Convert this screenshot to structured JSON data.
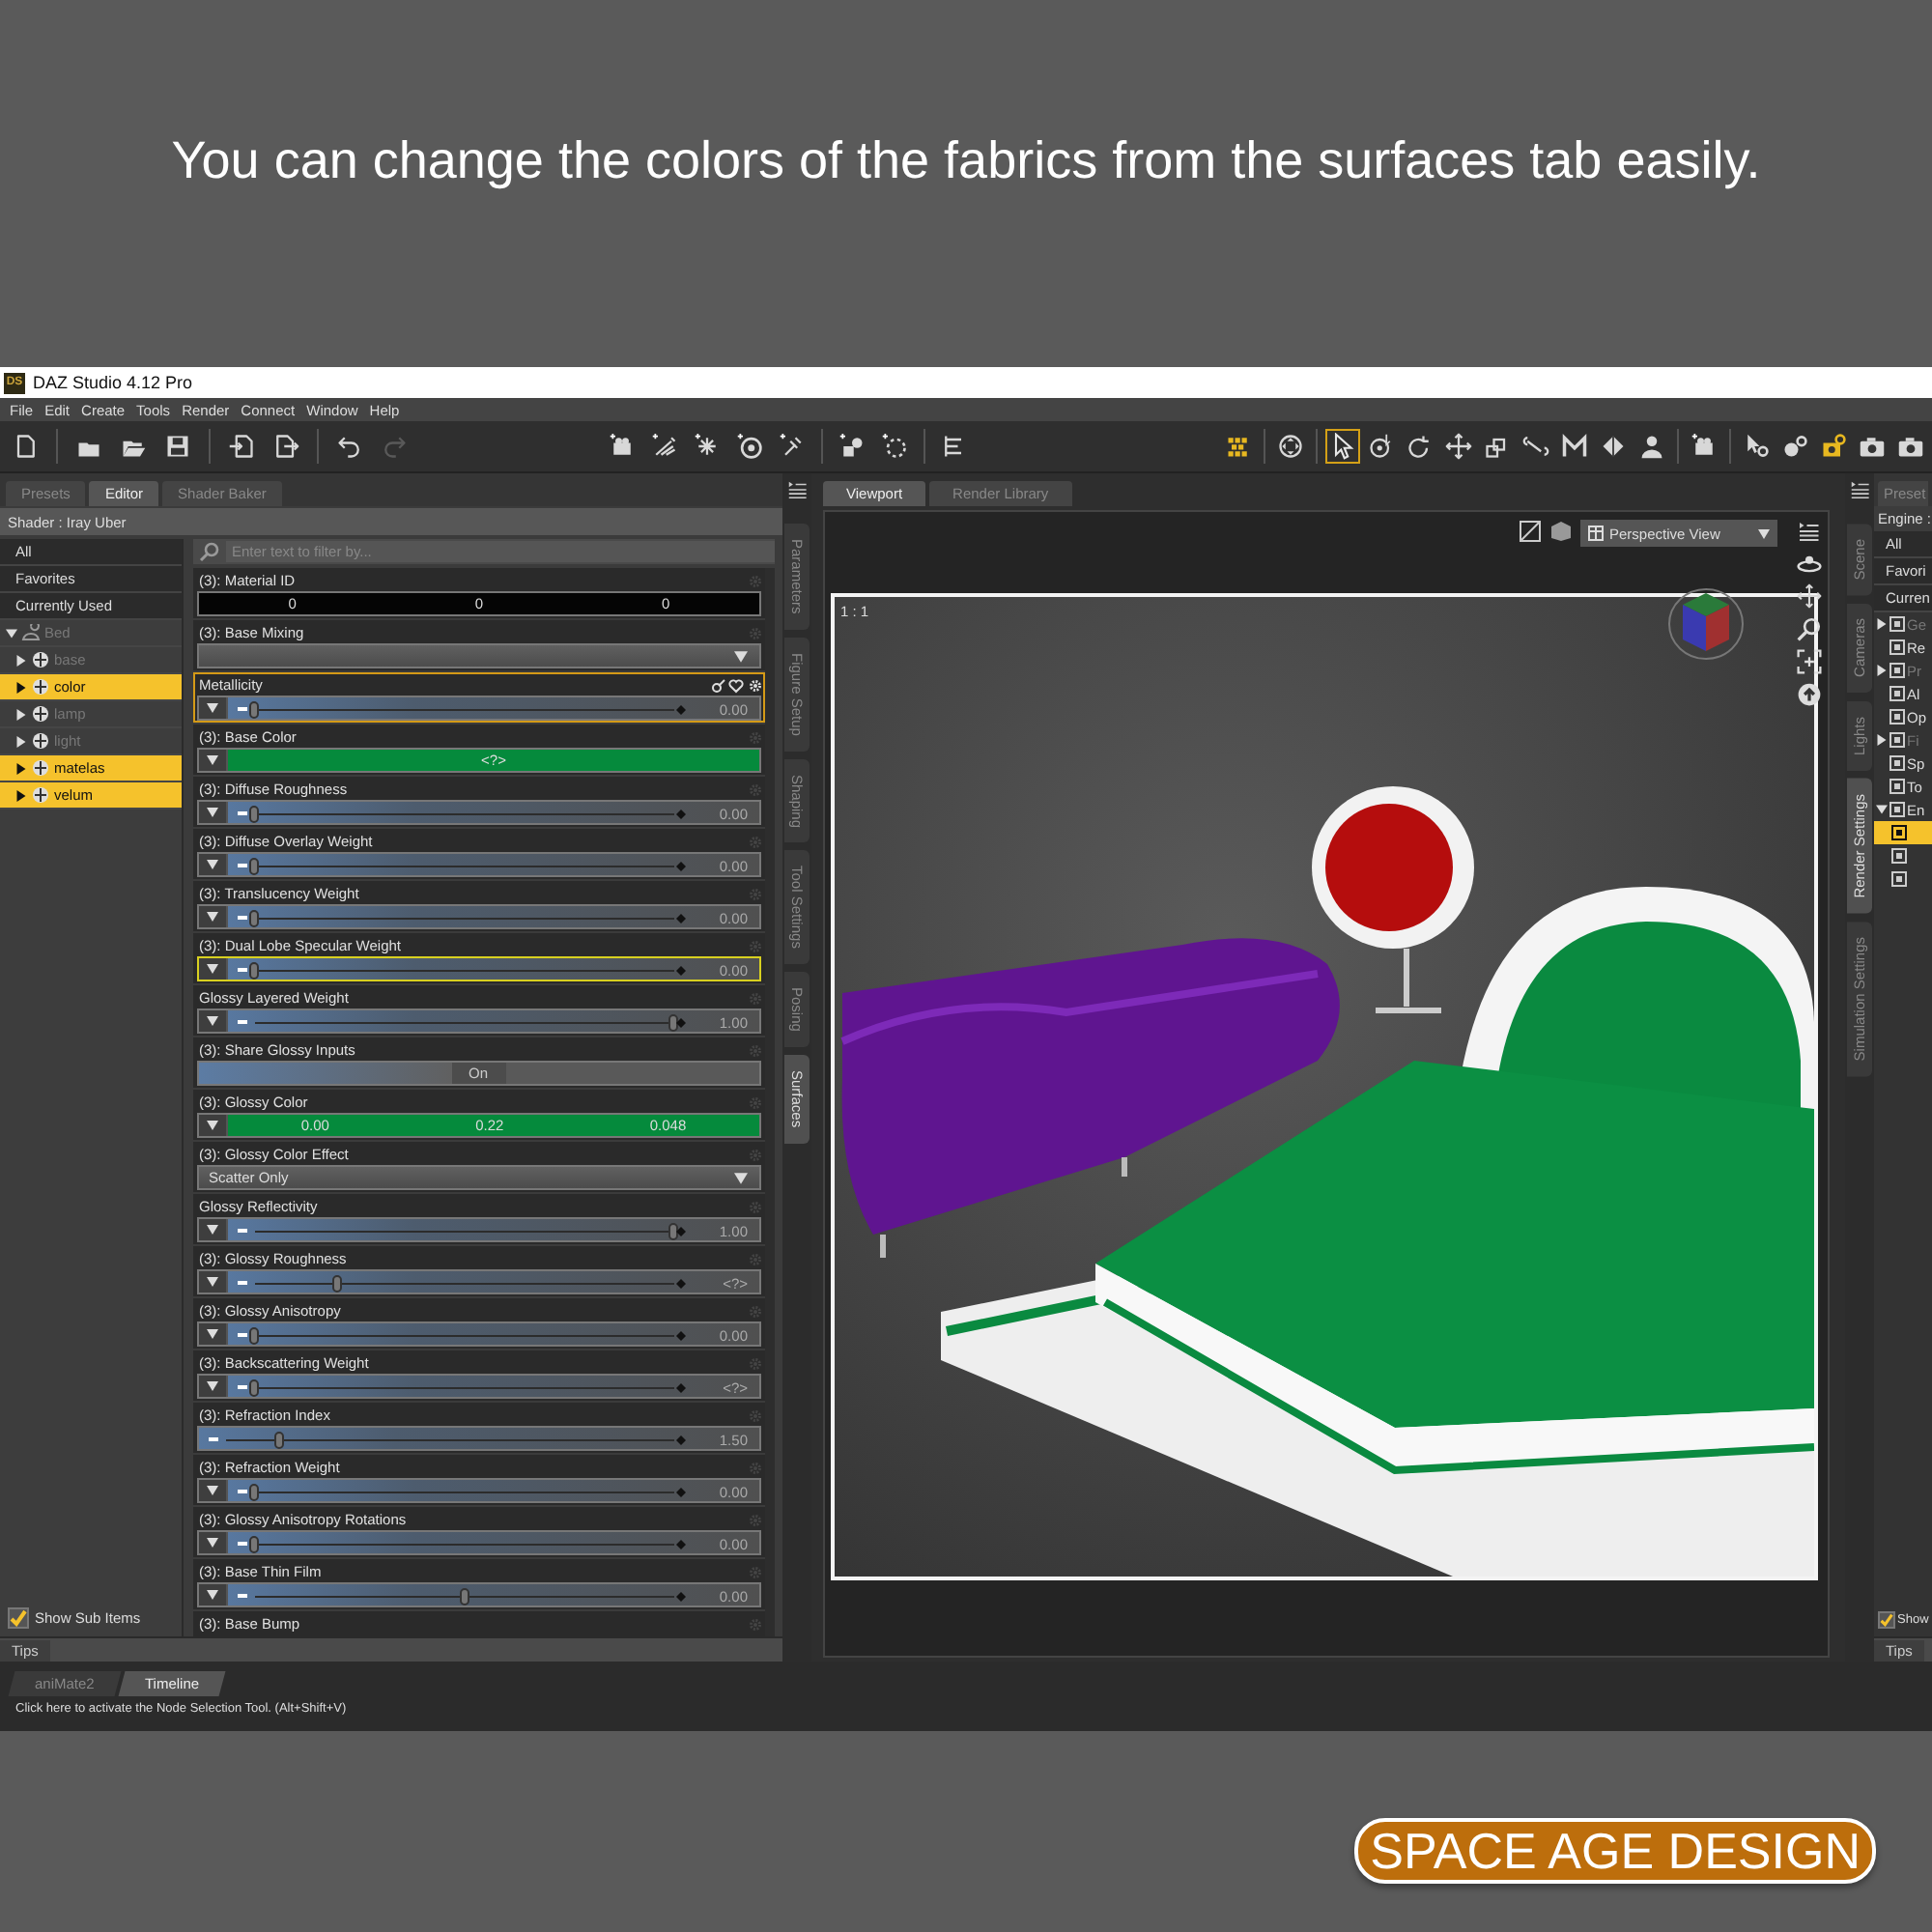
{
  "caption": "You can change the colors of the fabrics from the surfaces tab easily.",
  "window": {
    "icon_text": "DS",
    "title": "DAZ Studio 4.12 Pro"
  },
  "menu": [
    "File",
    "Edit",
    "Create",
    "Tools",
    "Render",
    "Connect",
    "Window",
    "Help"
  ],
  "toolbar": {
    "redo_disabled": true,
    "tools": [
      {
        "selected": false
      },
      {
        "selected": false
      },
      {
        "selected": true
      },
      {
        "selected": false
      },
      {
        "selected": false
      },
      {
        "selected": false
      },
      {
        "selected": false
      },
      {
        "selected": false
      },
      {
        "selected": false
      },
      {
        "selected": false
      },
      {
        "selected": false
      },
      {
        "selected": false
      },
      {
        "selected": false
      },
      {
        "selected": false
      },
      {
        "selected": false
      },
      {
        "selected": false
      },
      {
        "selected": false
      }
    ]
  },
  "surfaces_editor": {
    "tabs": [
      {
        "label": "Presets",
        "selected": false
      },
      {
        "label": "Editor",
        "selected": true
      },
      {
        "label": "Shader Baker",
        "selected": false
      }
    ],
    "shader": "Shader : Iray Uber",
    "categories": [
      {
        "label": "All",
        "selected": false
      },
      {
        "label": "Favorites",
        "selected": false
      },
      {
        "label": "Currently Used",
        "selected": false
      }
    ],
    "tree": [
      {
        "label": "Bed",
        "expanded": true,
        "disabled": true,
        "selected": false,
        "children": [
          {
            "label": "base",
            "disabled": true,
            "selected": false,
            "expanded": false
          },
          {
            "label": "color",
            "disabled": false,
            "selected": true,
            "expanded": false
          },
          {
            "label": "lamp",
            "disabled": true,
            "selected": false,
            "expanded": false
          },
          {
            "label": "light",
            "disabled": true,
            "selected": false,
            "expanded": false
          },
          {
            "label": "matelas",
            "disabled": false,
            "selected": true,
            "expanded": false
          },
          {
            "label": "velum",
            "disabled": false,
            "selected": true,
            "expanded": false
          }
        ]
      }
    ],
    "show_sub_items": {
      "label": "Show Sub Items",
      "checked": true
    },
    "filter": {
      "placeholder": "Enter text to filter by..."
    },
    "properties": [
      {
        "kind": "triple",
        "label": "(3): Material ID",
        "values": [
          "0",
          "0",
          "0"
        ],
        "selected": false,
        "hovered": false
      },
      {
        "kind": "dropdown",
        "label": "(3): Base Mixing",
        "selected": false,
        "hovered": false
      },
      {
        "kind": "slider",
        "label": "Metallicity",
        "level": 0,
        "value": "0.00",
        "menu_button": true,
        "selected": true,
        "hovered": false
      },
      {
        "kind": "color",
        "label": "(3): Base Color",
        "color": "#058a3c",
        "values": [
          "<?>"
        ],
        "selected": false,
        "hovered": false
      },
      {
        "kind": "slider",
        "label": "(3): Diffuse Roughness",
        "level": 0,
        "value": "0.00",
        "menu_button": true,
        "selected": false,
        "hovered": false
      },
      {
        "kind": "slider",
        "label": "(3): Diffuse Overlay Weight",
        "level": 0,
        "value": "0.00",
        "menu_button": true,
        "selected": false,
        "hovered": false
      },
      {
        "kind": "slider",
        "label": "(3): Translucency Weight",
        "level": 0,
        "value": "0.00",
        "menu_button": true,
        "selected": false,
        "hovered": false
      },
      {
        "kind": "slider",
        "label": "(3): Dual Lobe Specular Weight",
        "level": 0,
        "value": "0.00",
        "menu_button": true,
        "selected": false,
        "hovered": true
      },
      {
        "kind": "slider",
        "label": "Glossy Layered Weight",
        "level": 1,
        "value": "1.00",
        "menu_button": true,
        "selected": false,
        "hovered": false
      },
      {
        "kind": "toggle",
        "label": "(3): Share Glossy Inputs",
        "state_label": "On",
        "on": true,
        "selected": false,
        "hovered": false
      },
      {
        "kind": "color",
        "label": "(3): Glossy Color",
        "color": "#058a3c",
        "values": [
          "0.00",
          "0.22",
          "0.048"
        ],
        "selected": false,
        "hovered": false
      },
      {
        "kind": "dropdown",
        "label": "(3): Glossy Color Effect",
        "value": "Scatter Only",
        "selected": false,
        "hovered": false
      },
      {
        "kind": "slider",
        "label": "Glossy Reflectivity",
        "level": 1,
        "value": "1.00",
        "menu_button": true,
        "selected": false,
        "hovered": false
      },
      {
        "kind": "slider",
        "label": "(3): Glossy Roughness",
        "level": 0.2,
        "value": "<?>",
        "menu_button": true,
        "selected": false,
        "hovered": false
      },
      {
        "kind": "slider",
        "label": "(3): Glossy Anisotropy",
        "level": 0,
        "value": "0.00",
        "menu_button": true,
        "selected": false,
        "hovered": false
      },
      {
        "kind": "slider",
        "label": "(3): Backscattering Weight",
        "level": 0,
        "value": "<?>",
        "menu_button": true,
        "selected": false,
        "hovered": false
      },
      {
        "kind": "slider",
        "label": "(3): Refraction Index",
        "level": 0.12,
        "value": "1.50",
        "menu_button": false,
        "selected": false,
        "hovered": false
      },
      {
        "kind": "slider",
        "label": "(3): Refraction Weight",
        "level": 0,
        "value": "0.00",
        "menu_button": true,
        "selected": false,
        "hovered": false
      },
      {
        "kind": "slider",
        "label": "(3): Glossy Anisotropy Rotations",
        "level": 0,
        "value": "0.00",
        "menu_button": true,
        "selected": false,
        "hovered": false
      },
      {
        "kind": "slider",
        "label": "(3): Base Thin Film",
        "level": 0.5,
        "value": "0.00",
        "menu_button": true,
        "selected": false,
        "hovered": false
      },
      {
        "kind": "header",
        "label": "(3): Base Bump",
        "selected": false,
        "hovered": false
      }
    ],
    "tips": "Tips"
  },
  "left_side_tabs": [
    {
      "label": "Parameters",
      "selected": false
    },
    {
      "label": "Figure Setup",
      "selected": false
    },
    {
      "label": "Shaping",
      "selected": false
    },
    {
      "label": "Tool Settings",
      "selected": false
    },
    {
      "label": "Posing",
      "selected": false
    },
    {
      "label": "Surfaces",
      "selected": true
    }
  ],
  "viewport": {
    "tabs": [
      {
        "label": "Viewport",
        "selected": true
      },
      {
        "label": "Render Library",
        "selected": false
      }
    ],
    "view": "Perspective View",
    "ratio": "1 : 1"
  },
  "right_side_tabs": [
    {
      "label": "Scene",
      "selected": false
    },
    {
      "label": "Cameras",
      "selected": false
    },
    {
      "label": "Lights",
      "selected": false
    },
    {
      "label": "Render Settings",
      "selected": true
    },
    {
      "label": "Simulation Settings",
      "selected": false
    }
  ],
  "render_settings": {
    "tab": "Preset",
    "engine": "Engine :",
    "categories": [
      {
        "label": "All",
        "selected": false
      },
      {
        "label": "Favori",
        "selected": false
      },
      {
        "label": "Curren",
        "selected": false
      }
    ],
    "tree": [
      {
        "label": "Ge",
        "disabled": true,
        "expanded": false
      },
      {
        "label": "Re",
        "disabled": false
      },
      {
        "label": "Pr",
        "disabled": true,
        "expanded": false
      },
      {
        "label": "Al",
        "disabled": false
      },
      {
        "label": "Op",
        "disabled": false
      },
      {
        "label": "Fi",
        "disabled": true,
        "expanded": false
      },
      {
        "label": "Sp",
        "disabled": false
      },
      {
        "label": "To",
        "disabled": false
      },
      {
        "label": "En",
        "disabled": false,
        "expanded": true,
        "children": [
          {
            "selected": true
          },
          {
            "selected": false
          },
          {
            "selected": false
          }
        ]
      }
    ],
    "show": {
      "label": "Show",
      "checked": true
    },
    "tips": "Tips"
  },
  "bottom": {
    "tabs": [
      {
        "label": "aniMate2",
        "selected": false
      },
      {
        "label": "Timeline",
        "selected": true
      }
    ],
    "status": "Click here to activate the Node Selection Tool. (Alt+Shift+V)"
  },
  "brand": "SPACE AGE DESIGN"
}
